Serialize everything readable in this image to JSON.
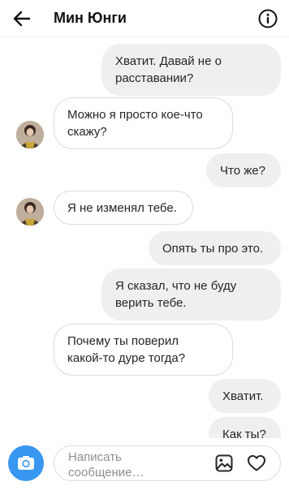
{
  "header": {
    "title": "Мин Юнги",
    "back_icon": "arrow-left-icon",
    "info_icon": "info-circle-icon"
  },
  "messages": [
    {
      "side": "out",
      "text": "Хватит. Давай не о\nрасставании?"
    },
    {
      "side": "in",
      "text": "Можно я просто кое-что\nскажу?"
    },
    {
      "side": "out",
      "text": "Что же?"
    },
    {
      "side": "in",
      "text": "Я не изменял тебе."
    },
    {
      "side": "out",
      "text": "Опять ты про это."
    },
    {
      "side": "out",
      "text": "Я сказал, что не буду\nверить тебе."
    },
    {
      "side": "in",
      "text": "Почему ты поверил\nкакой-то дуре тогда?"
    },
    {
      "side": "out",
      "text": "Хватит."
    },
    {
      "side": "out",
      "text": "Как ты?"
    }
  ],
  "composer": {
    "placeholder": "Написать\nсообщение…",
    "camera_icon": "camera-icon",
    "gallery_icon": "image-icon",
    "like_icon": "heart-icon"
  },
  "colors": {
    "camera_button": "#3897f0",
    "outgoing_bubble": "#efefef",
    "incoming_border": "#dbdbdb"
  }
}
